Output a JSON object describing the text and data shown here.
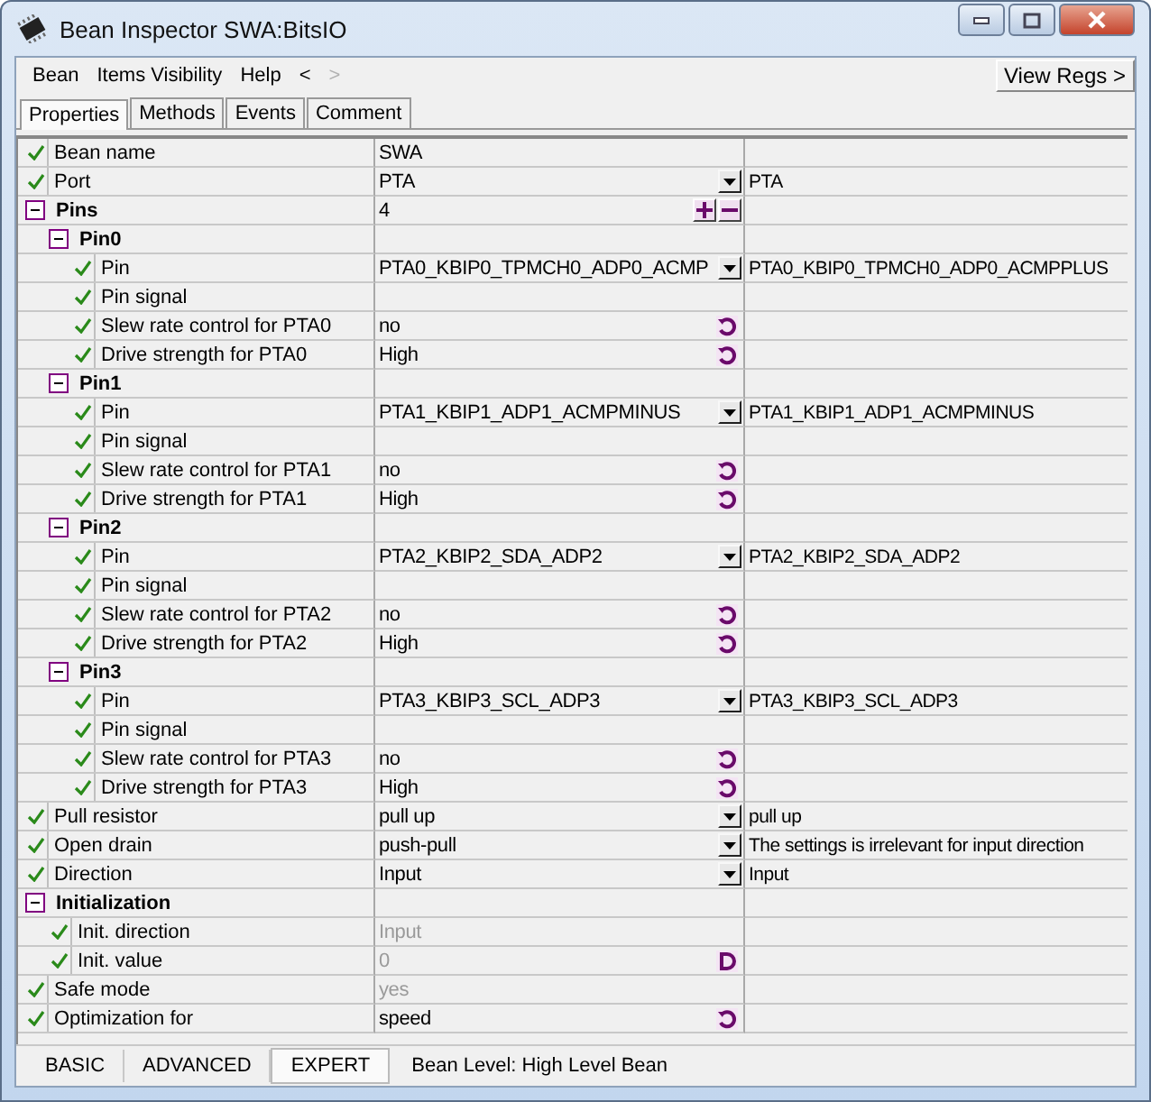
{
  "window": {
    "title": "Bean Inspector SWA:BitsIO"
  },
  "menu": [
    {
      "label": "Bean",
      "disabled": false
    },
    {
      "label": "Items Visibility",
      "disabled": false
    },
    {
      "label": "Help",
      "disabled": false
    },
    {
      "label": "<",
      "disabled": false
    },
    {
      "label": ">",
      "disabled": true
    }
  ],
  "view_regs_button": "View Regs >",
  "tabs": [
    {
      "label": "Properties",
      "selected": true
    },
    {
      "label": "Methods",
      "selected": false
    },
    {
      "label": "Events",
      "selected": false
    },
    {
      "label": "Comment",
      "selected": false
    }
  ],
  "properties": [
    {
      "kind": "prop",
      "name": "Bean name",
      "checked": true,
      "value": "SWA"
    },
    {
      "kind": "prop",
      "name": "Port",
      "checked": true,
      "value": "PTA",
      "editor": {
        "kind": "dropdown"
      },
      "extra": "PTA"
    },
    {
      "kind": "group",
      "name": "Pins",
      "expanded": true,
      "value": "4",
      "editor": {
        "kind": "plusminus"
      },
      "children": [
        {
          "kind": "group",
          "name": "Pin0",
          "expanded": true,
          "children": [
            {
              "kind": "prop",
              "name": "Pin",
              "checked": true,
              "value": "PTA0_KBIP0_TPMCH0_ADP0_ACMP",
              "editor": {
                "kind": "dropdown"
              },
              "extra": "PTA0_KBIP0_TPMCH0_ADP0_ACMPPLUS"
            },
            {
              "kind": "prop",
              "name": "Pin signal",
              "checked": true
            },
            {
              "kind": "prop",
              "name": "Slew rate control for PTA0",
              "checked": true,
              "value": "no",
              "editor": {
                "kind": "cycle"
              }
            },
            {
              "kind": "prop",
              "name": "Drive strength for PTA0",
              "checked": true,
              "value": "High",
              "editor": {
                "kind": "cycle"
              }
            }
          ]
        },
        {
          "kind": "group",
          "name": "Pin1",
          "expanded": true,
          "children": [
            {
              "kind": "prop",
              "name": "Pin",
              "checked": true,
              "value": "PTA1_KBIP1_ADP1_ACMPMINUS",
              "editor": {
                "kind": "dropdown"
              },
              "extra": "PTA1_KBIP1_ADP1_ACMPMINUS"
            },
            {
              "kind": "prop",
              "name": "Pin signal",
              "checked": true
            },
            {
              "kind": "prop",
              "name": "Slew rate control for PTA1",
              "checked": true,
              "value": "no",
              "editor": {
                "kind": "cycle"
              }
            },
            {
              "kind": "prop",
              "name": "Drive strength for PTA1",
              "checked": true,
              "value": "High",
              "editor": {
                "kind": "cycle"
              }
            }
          ]
        },
        {
          "kind": "group",
          "name": "Pin2",
          "expanded": true,
          "children": [
            {
              "kind": "prop",
              "name": "Pin",
              "checked": true,
              "value": "PTA2_KBIP2_SDA_ADP2",
              "editor": {
                "kind": "dropdown"
              },
              "extra": "PTA2_KBIP2_SDA_ADP2"
            },
            {
              "kind": "prop",
              "name": "Pin signal",
              "checked": true
            },
            {
              "kind": "prop",
              "name": "Slew rate control for PTA2",
              "checked": true,
              "value": "no",
              "editor": {
                "kind": "cycle"
              }
            },
            {
              "kind": "prop",
              "name": "Drive strength for PTA2",
              "checked": true,
              "value": "High",
              "editor": {
                "kind": "cycle"
              }
            }
          ]
        },
        {
          "kind": "group",
          "name": "Pin3",
          "expanded": true,
          "children": [
            {
              "kind": "prop",
              "name": "Pin",
              "checked": true,
              "value": "PTA3_KBIP3_SCL_ADP3",
              "editor": {
                "kind": "dropdown"
              },
              "extra": "PTA3_KBIP3_SCL_ADP3"
            },
            {
              "kind": "prop",
              "name": "Pin signal",
              "checked": true
            },
            {
              "kind": "prop",
              "name": "Slew rate control for PTA3",
              "checked": true,
              "value": "no",
              "editor": {
                "kind": "cycle"
              }
            },
            {
              "kind": "prop",
              "name": "Drive strength for PTA3",
              "checked": true,
              "value": "High",
              "editor": {
                "kind": "cycle"
              }
            }
          ]
        }
      ]
    },
    {
      "kind": "prop",
      "name": "Pull resistor",
      "checked": true,
      "value": "pull up",
      "editor": {
        "kind": "dropdown"
      },
      "extra": "pull up"
    },
    {
      "kind": "prop",
      "name": "Open drain",
      "checked": true,
      "value": "push-pull",
      "editor": {
        "kind": "dropdown"
      },
      "extra": "The settings is irrelevant for input direction"
    },
    {
      "kind": "prop",
      "name": "Direction",
      "checked": true,
      "value": "Input",
      "editor": {
        "kind": "dropdown"
      },
      "extra": "Input"
    },
    {
      "kind": "group",
      "name": "Initialization",
      "expanded": true,
      "children": [
        {
          "kind": "prop",
          "name": "Init. direction",
          "checked": true,
          "value": "Input",
          "disabled": true
        },
        {
          "kind": "prop",
          "name": "Init. value",
          "checked": true,
          "value": "0",
          "disabled": true,
          "editor": {
            "kind": "dialog"
          }
        }
      ]
    },
    {
      "kind": "prop",
      "name": "Safe mode",
      "checked": true,
      "value": "yes",
      "disabled": true
    },
    {
      "kind": "prop",
      "name": "Optimization for",
      "checked": true,
      "value": "speed",
      "editor": {
        "kind": "cycle"
      }
    }
  ],
  "levels": [
    {
      "label": "BASIC",
      "selected": false
    },
    {
      "label": "ADVANCED",
      "selected": false
    },
    {
      "label": "EXPERT",
      "selected": true
    }
  ],
  "status": "Bean Level: High Level Bean"
}
